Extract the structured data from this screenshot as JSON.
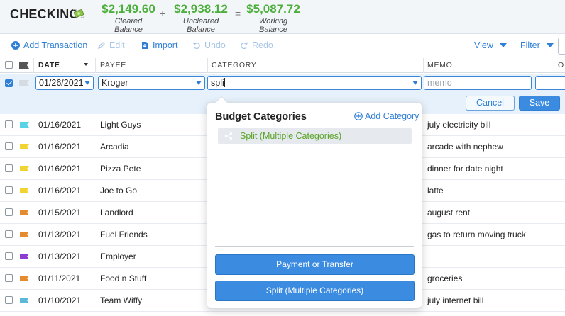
{
  "header": {
    "account_title": "CHECKING",
    "money_icon": "money-with-wings-icon",
    "cleared": {
      "amount": "$2,149.60",
      "label": "Cleared Balance"
    },
    "plus": "+",
    "uncleared": {
      "amount": "$2,938.12",
      "label": "Uncleared Balance"
    },
    "equals": "=",
    "working": {
      "amount": "$5,087.72",
      "label": "Working Balance"
    }
  },
  "toolbar": {
    "add_transaction": "Add Transaction",
    "edit": "Edit",
    "import": "Import",
    "undo": "Undo",
    "redo": "Redo",
    "view": "View",
    "filter": "Filter"
  },
  "columns": {
    "date": "DATE",
    "payee": "PAYEE",
    "category": "CATEGORY",
    "memo": "MEMO",
    "outflow_partial": "O"
  },
  "edit_row": {
    "date": "01/26/2021",
    "payee": "Kroger",
    "category": "spli",
    "memo_placeholder": "memo",
    "cancel": "Cancel",
    "save": "Save"
  },
  "rows": [
    {
      "date": "01/16/2021",
      "payee": "Light Guys",
      "memo": "july electricity bill",
      "flag": "#5bd3e6"
    },
    {
      "date": "01/16/2021",
      "payee": "Arcadia",
      "memo": "arcade with nephew",
      "flag": "#f2d430"
    },
    {
      "date": "01/16/2021",
      "payee": "Pizza Pete",
      "memo": "dinner for date night",
      "flag": "#f2d430"
    },
    {
      "date": "01/16/2021",
      "payee": "Joe to Go",
      "memo": "latte",
      "flag": "#f2d430"
    },
    {
      "date": "01/15/2021",
      "payee": "Landlord",
      "memo": "august rent",
      "flag": "#e58a2e"
    },
    {
      "date": "01/13/2021",
      "payee": "Fuel Friends",
      "memo": "gas to return moving truck",
      "flag": "#e58a2e"
    },
    {
      "date": "01/13/2021",
      "payee": "Employer",
      "memo": "",
      "flag": "#8e3bd1"
    },
    {
      "date": "01/11/2021",
      "payee": "Food n Stuff",
      "memo": "groceries",
      "flag": "#e58a2e"
    },
    {
      "date": "01/10/2021",
      "payee": "Team Wiffy",
      "memo": "july internet bill",
      "flag": "#5bb8d6"
    }
  ],
  "dropdown": {
    "title": "Budget Categories",
    "add_category": "Add Category",
    "items": [
      "Split (Multiple Categories)"
    ],
    "button_payment": "Payment or Transfer",
    "button_split": "Split (Multiple Categories)"
  },
  "colors": {
    "accent": "#2f7fd6",
    "balance_green": "#4caf3c",
    "edit_row_bg": "#e6f1fb",
    "dropdown_item_text": "#5aa528"
  }
}
